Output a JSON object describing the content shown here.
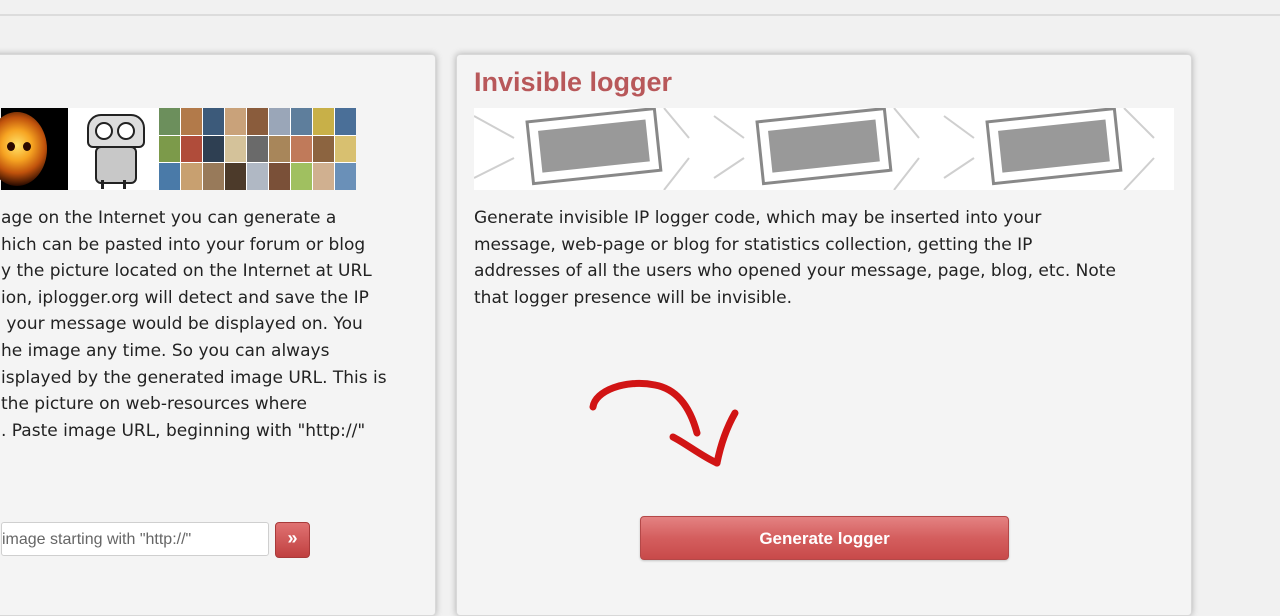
{
  "left_panel": {
    "description_lines": [
      "age on the Internet you can generate a",
      "hich can be pasted into your forum or blog",
      "y the picture located on the Internet at URL",
      "ion, iplogger.org will detect and save the IP",
      " your message would be displayed on. You",
      "he image any time. So you can always",
      "isplayed by the generated image URL. This is",
      "the picture on web-resources where",
      ". Paste image URL, beginning with \"http://\""
    ],
    "url_input_placeholder": "image starting with \"http://\"",
    "submit_label": "»"
  },
  "right_panel": {
    "title": "Invisible logger",
    "description_lines": [
      "Generate invisible IP logger code, which may be inserted into your",
      "message, web-page or blog for statistics collection, getting the IP",
      "addresses of all the users who opened your message, page, blog, etc. Note",
      "that logger presence will be invisible."
    ],
    "generate_button_label": "Generate logger"
  },
  "colors": {
    "title": "#b8585a",
    "button": "#d45e5e",
    "annotation_arrow": "#d11414"
  }
}
